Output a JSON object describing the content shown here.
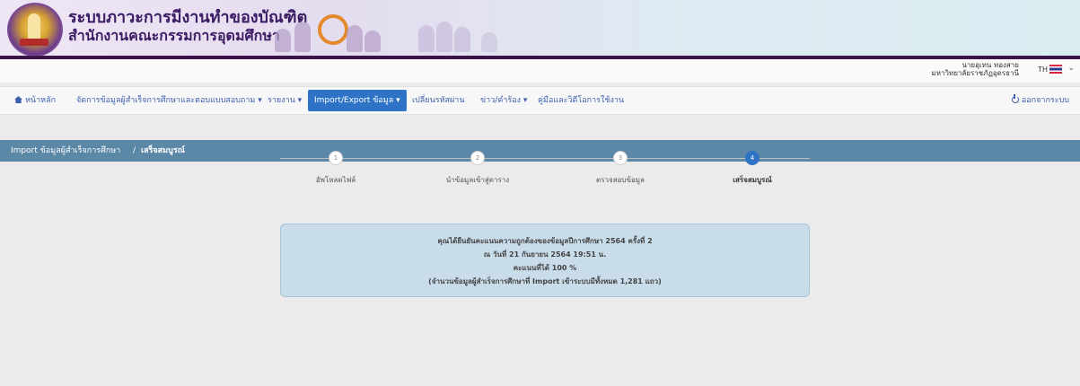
{
  "header": {
    "title_line1": "ระบบภาวะการมีงานทำของบัณฑิต",
    "title_line2": "สำนักงานคณะกรรมการอุดมศึกษา",
    "user_name": "นายอุเทน ทองสาย",
    "user_org": "มหาวิทยาลัยราชภัฏอุดรธานี",
    "lang": "TH"
  },
  "nav": {
    "home": "หน้าหลัก",
    "manage": "จัดการข้อมูลผู้สำเร็จการศึกษาและตอบแบบสอบถาม",
    "report": "รายงาน",
    "import_export": "Import/Export ข้อมูล",
    "change_password": "เปลี่ยนรหัสผ่าน",
    "news": "ข่าว/คำร้อง",
    "manual": "คู่มือและวิดีโอการใช้งาน",
    "logout": "ออกจากระบบ"
  },
  "breadcrumb": {
    "parent": "Import ข้อมูลผู้สำเร็จการศึกษา",
    "separator": "/",
    "current": "เสร็จสมบูรณ์"
  },
  "steps": [
    {
      "num": "1",
      "label": "อัพโหลดไฟล์"
    },
    {
      "num": "2",
      "label": "นำข้อมูลเข้าสู่ตาราง"
    },
    {
      "num": "3",
      "label": "ตรวจสอบข้อมูล"
    },
    {
      "num": "4",
      "label": "เสร็จสมบูรณ์"
    }
  ],
  "message": {
    "line1": "คุณได้ยืนยันคะแนนความถูกต้องของข้อมูลปีการศึกษา 2564 ครั้งที่ 2",
    "line2": "ณ วันที่ 21 กันยายน 2564 19:51 น.",
    "line3": "คะแนนที่ได้ 100 %",
    "line4": "(จำนวนข้อมูลผู้สำเร็จการศึกษาที่ Import เข้าระบบมีทั้งหมด 1,281 แถว)"
  },
  "colors": {
    "nav_active": "#2f73c7",
    "breadcrumb_bg": "#5b88a7",
    "message_bg": "#c9dcea"
  }
}
